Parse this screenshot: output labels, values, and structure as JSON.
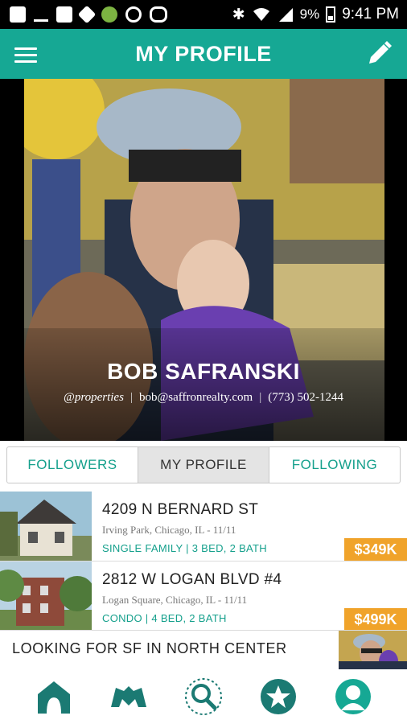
{
  "status_bar": {
    "battery": "9%",
    "time": "9:41 PM",
    "icons": [
      "add-box-icon",
      "missed-call-icon",
      "image-icon",
      "dropbox-icon",
      "android-icon",
      "vpn-icon",
      "sync-icon",
      "bluetooth-icon",
      "wifi-icon",
      "signal-icon",
      "battery-icon"
    ]
  },
  "app_bar": {
    "title": "MY PROFILE",
    "menu_icon": "hamburger-menu-icon",
    "edit_icon": "pencil-icon"
  },
  "profile": {
    "name": "BOB SAFRANSKI",
    "company": "@properties",
    "email": "bob@saffronrealty.com",
    "phone": "(773) 502-1244",
    "separator": "|"
  },
  "tabs": [
    {
      "label": "FOLLOWERS",
      "active": false
    },
    {
      "label": "MY PROFILE",
      "active": true
    },
    {
      "label": "FOLLOWING",
      "active": false
    }
  ],
  "listings": [
    {
      "address": "4209 N BERNARD ST",
      "location": "Irving Park, Chicago, IL  -  11/11",
      "details": "SINGLE FAMILY | 3 BED, 2 BATH",
      "price": "$349K"
    },
    {
      "address": "2812 W LOGAN BLVD #4",
      "location": "Logan Square, Chicago, IL  -  11/11",
      "details": "CONDO | 4 BED, 2 BATH",
      "price": "$499K"
    }
  ],
  "request": {
    "text": "LOOKING FOR SF IN NORTH CENTER"
  },
  "bottom_nav": [
    {
      "icon": "home-icon"
    },
    {
      "icon": "handshake-icon"
    },
    {
      "icon": "search-icon"
    },
    {
      "icon": "star-icon"
    },
    {
      "icon": "profile-icon"
    }
  ],
  "colors": {
    "accent": "#16a894",
    "price_badge": "#f0a32a",
    "active_tab_bg": "#e4e4e4"
  }
}
